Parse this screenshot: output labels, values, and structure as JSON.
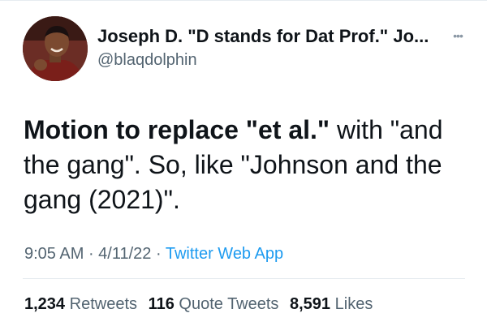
{
  "author": {
    "display_name": "Joseph D. \"D stands for Dat Prof.\" Jo...",
    "handle": "@blaqdolphin"
  },
  "icons": {
    "more": "more-options-icon",
    "avatar": "profile-photo"
  },
  "tweet": {
    "bold_text": "Motion to replace \"et al.\"",
    "text": " with \"and the gang\". So, like \"Johnson and the gang (2021)\"."
  },
  "meta": {
    "time": "9:05 AM",
    "separator_1": " · ",
    "date": "4/11/22",
    "separator_2": " · ",
    "source": "Twitter Web App"
  },
  "stats": {
    "retweets_count": "1,234",
    "retweets_label": "Retweets",
    "quotes_count": "116",
    "quotes_label": "Quote Tweets",
    "likes_count": "8,591",
    "likes_label": "Likes"
  },
  "colors": {
    "link": "#1d9bf0",
    "secondary_text": "#536471",
    "primary_text": "#0f1419",
    "divider": "#e6ecf0"
  }
}
